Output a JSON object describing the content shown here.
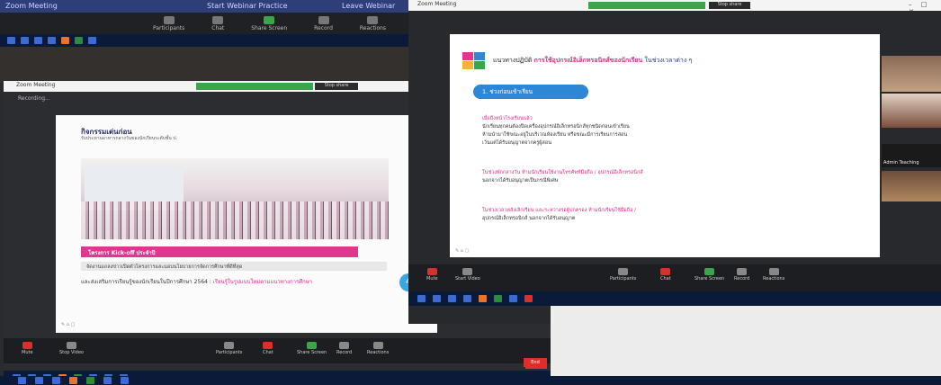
{
  "background_window": {
    "topbar": [
      "Zoom Meeting",
      "Start Webinar Practice",
      "Leave Webinar"
    ],
    "toolbar": [
      "Participants",
      "Chat",
      "Share Screen",
      "Record",
      "Reactions"
    ]
  },
  "inner_window": {
    "title": "Zoom Meeting",
    "button_label": "Stop share",
    "recording_label": "Recording...",
    "toolbar": [
      {
        "label": "Mute",
        "icon": "mic-icon"
      },
      {
        "label": "Stop Video",
        "icon": "video-icon"
      },
      {
        "label": "Participants",
        "icon": "participants-icon"
      },
      {
        "label": "Chat",
        "icon": "chat-icon"
      },
      {
        "label": "Share Screen",
        "icon": "share-icon"
      },
      {
        "label": "Record",
        "icon": "record-icon"
      },
      {
        "label": "Reactions",
        "icon": "reactions-icon"
      }
    ],
    "end_label": "End",
    "slide": {
      "header_title": "กิจกรรมเด่นก่อน",
      "header_sub": "รับประทานอาหารกลางวันของนักเรียนระดับชั้น ป.",
      "banner": "โครงการ Kick-off ประจำปี",
      "line2": "จัดงานแถลงข่าวเปิดตัวโครงการและมอบนโยบายการจัดการศึกษาที่ดีที่สุด",
      "line3_prefix": "และส่งเสริมการเรียนรู้ของนักเรียนในปีการศึกษา 2564 :",
      "line3_highlight": "เรียนรู้ในรูปแบบใหม่ตามแนวทางการศึกษา",
      "badge": "4"
    }
  },
  "front_window": {
    "title": "Zoom Meeting",
    "button_label": "Stop share",
    "window_controls": "– □ ✕",
    "slide": {
      "title_prefix": "แนวทางปฏิบัติ",
      "title_highlight": "การใช้อุปกรณ์อิเล็กทรอนิกส์ของนักเรียน",
      "title_suffix": "ในช่วงเวลาต่าง ๆ",
      "pill": "1. ช่วงก่อนเข้าเรียน",
      "lines": [
        {
          "text": "เมื่อถึงหน้าโรงเรียนแล้ว",
          "pink": true
        },
        {
          "text": "นักเรียนทุกคนต้องปิดเครื่องอุปกรณ์อิเล็กทรอนิกส์ทุกชนิดก่อนเข้าเรียน",
          "pink": false
        },
        {
          "text": "ห้ามนำมาใช้ขณะอยู่ในบริเวณห้องเรียน หรือขณะมีการเรียนการสอน",
          "pink": false
        },
        {
          "text": "เว้นแต่ได้รับอนุญาตจากครูผู้สอน",
          "pink": false
        },
        {
          "text": "ในช่วงพักกลางวัน ห้ามนักเรียนใช้งานโทรศัพท์มือถือ / อุปกรณ์อิเล็กทรอนิกส์",
          "pink": true
        },
        {
          "text": "นอกจากได้รับอนุญาตเป็นกรณีพิเศษ",
          "pink": false
        },
        {
          "text": "ในช่วงเวลาหลังเลิกเรียน และระหว่างรอผู้ปกครอง ห้ามนักเรียนใช้มือถือ /",
          "pink": true
        },
        {
          "text": "อุปกรณ์อิเล็กทรอนิกส์ นอกจากได้รับอนุญาต",
          "pink": false
        }
      ]
    },
    "toolbar": [
      {
        "label": "Mute",
        "icon": "mic-icon"
      },
      {
        "label": "Start Video",
        "icon": "video-icon"
      },
      {
        "label": "Participants",
        "icon": "participants-icon"
      },
      {
        "label": "Chat",
        "icon": "chat-icon"
      },
      {
        "label": "Share Screen",
        "icon": "share-icon"
      },
      {
        "label": "Record",
        "icon": "record-icon"
      },
      {
        "label": "Reactions",
        "icon": "reactions-icon"
      }
    ]
  },
  "gallery": [
    {
      "caption": ""
    },
    {
      "caption": ""
    },
    {
      "caption": "Admin Teaching"
    },
    {
      "caption": ""
    }
  ],
  "end_label": "End",
  "colors": {
    "accent_pink": "#d92e84",
    "accent_blue": "#2e86d6",
    "zoom_green": "#3aa64a",
    "end_red": "#d9302c"
  }
}
